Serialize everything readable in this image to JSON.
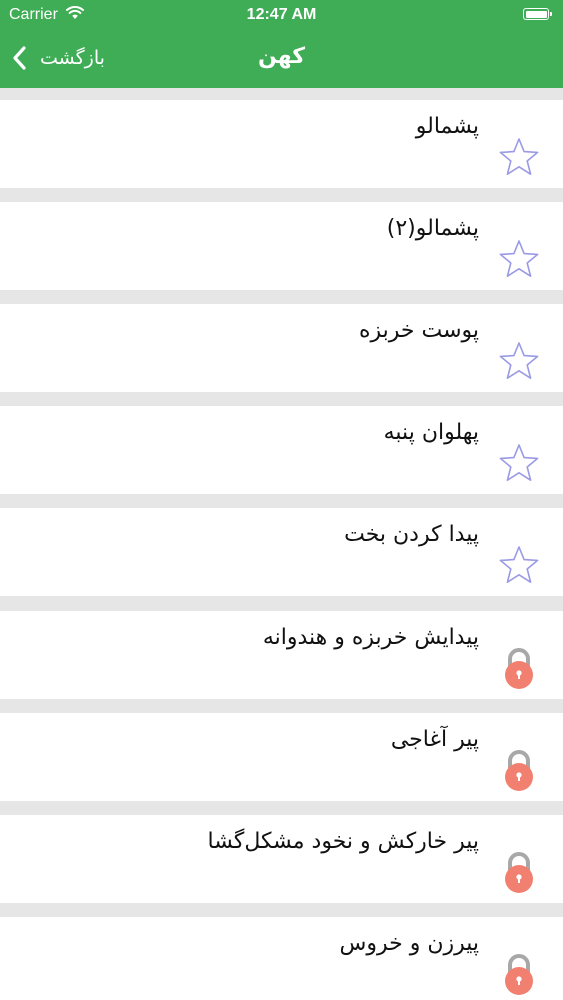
{
  "status_bar": {
    "carrier": "Carrier",
    "time": "12:47 AM"
  },
  "nav": {
    "title": "کهن",
    "back_label": "بازگشت"
  },
  "colors": {
    "nav_background": "#3fad56",
    "star_outline": "#9a9ae6",
    "lock_body": "#f28070",
    "lock_shackle": "#a8a8a8"
  },
  "items": [
    {
      "title": "پشمالو",
      "status": "star-icon"
    },
    {
      "title": "پشمالو(۲)",
      "status": "star-icon"
    },
    {
      "title": "پوست خربزه",
      "status": "star-icon"
    },
    {
      "title": "پهلوان پنبه",
      "status": "star-icon"
    },
    {
      "title": "پیدا کردن بخت",
      "status": "star-icon"
    },
    {
      "title": "پیدایش خربزه و هندوانه",
      "status": "lock-icon"
    },
    {
      "title": "پیر آغاجی",
      "status": "lock-icon"
    },
    {
      "title": "پیر خارکش و نخود مشکل‌گشا",
      "status": "lock-icon"
    },
    {
      "title": "پیرزن و خروس",
      "status": "lock-icon"
    }
  ]
}
